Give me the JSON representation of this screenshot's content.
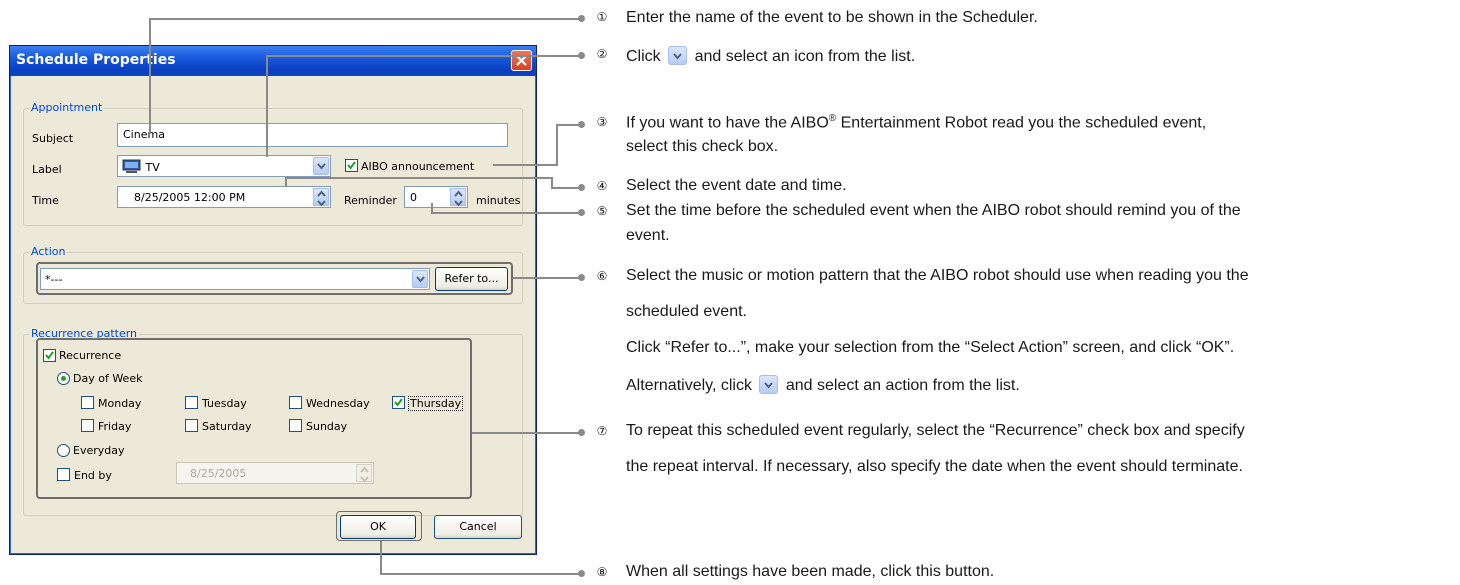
{
  "dialog": {
    "title": "Schedule Properties",
    "appointment": {
      "group_label": "Appointment",
      "subject_label": "Subject",
      "subject_value": "Cinema",
      "label_label": "Label",
      "label_value": "TV",
      "label_icon": "tv-icon",
      "aibo_announcement_label": "AIBO announcement",
      "aibo_announcement_checked": true,
      "time_label": "Time",
      "time_value": "8/25/2005 12:00 PM",
      "reminder_label": "Reminder",
      "reminder_value": "0",
      "minutes_label": "minutes"
    },
    "action": {
      "group_label": "Action",
      "value": "*---",
      "refer_button": "Refer to..."
    },
    "recurrence": {
      "group_label": "Recurrence pattern",
      "recurrence_label": "Recurrence",
      "recurrence_checked": true,
      "day_of_week_label": "Day of Week",
      "days": [
        {
          "label": "Monday",
          "checked": false
        },
        {
          "label": "Tuesday",
          "checked": false
        },
        {
          "label": "Wednesday",
          "checked": false
        },
        {
          "label": "Thursday",
          "checked": true
        },
        {
          "label": "Friday",
          "checked": false
        },
        {
          "label": "Saturday",
          "checked": false
        },
        {
          "label": "Sunday",
          "checked": false
        }
      ],
      "everyday_label": "Everyday",
      "end_by_label": "End by",
      "end_by_value": "8/25/2005"
    },
    "ok_button": "OK",
    "cancel_button": "Cancel"
  },
  "callouts": [
    {
      "number": "①",
      "text": "Enter the name of the event to be shown in the Scheduler."
    },
    {
      "number": "②",
      "text_before": "Click",
      "text_after": "and select an icon from the list."
    },
    {
      "number": "③",
      "line1_before": "If you want to have the AIBO",
      "line1_sup": "®",
      "line1_after": " Entertainment Robot read you the scheduled event,",
      "line2": "select this check box."
    },
    {
      "number": "④",
      "text": "Select the event date and time."
    },
    {
      "number": "⑤",
      "line1": "Set the time before the scheduled event when the AIBO robot should remind you of the",
      "line2": "event."
    },
    {
      "number": "⑥",
      "line1": "Select the music or motion pattern that the AIBO robot should use when reading you the",
      "line2": "scheduled event.",
      "line3": "Click “Refer to...”, make your selection from the “Select Action” screen, and click “OK”.",
      "line4_before": "Alternatively, click",
      "line4_after": "and select an action from the list."
    },
    {
      "number": "⑦",
      "line1": "To repeat this scheduled event regularly, select the “Recurrence” check box and specify",
      "line2": "the repeat interval. If necessary, also specify the date when the event should terminate."
    },
    {
      "number": "⑧",
      "text": "When all settings have been made, click this button."
    }
  ],
  "colors": {
    "titlebar": "#0a3fc0",
    "dialog_bg": "#ece9d8",
    "group_label": "#0046d5",
    "callout_line": "#8a8a8a"
  }
}
